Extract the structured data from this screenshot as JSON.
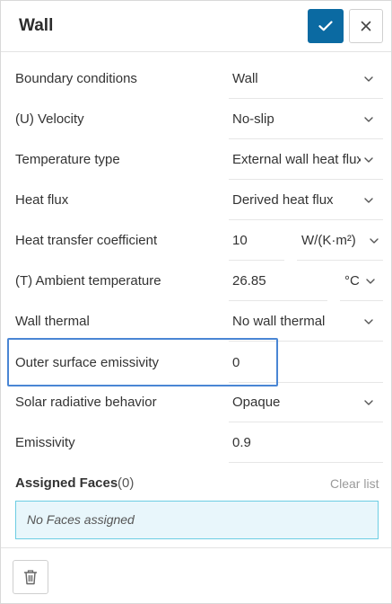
{
  "header": {
    "title": "Wall"
  },
  "rows": {
    "boundary_conditions": {
      "label": "Boundary conditions",
      "value": "Wall"
    },
    "velocity": {
      "label": "(U) Velocity",
      "value": "No-slip"
    },
    "temperature_type": {
      "label": "Temperature type",
      "value": "External wall heat flux"
    },
    "heat_flux": {
      "label": "Heat flux",
      "value": "Derived heat flux"
    },
    "heat_transfer_coefficient": {
      "label": "Heat transfer coefficient",
      "value": "10",
      "unit": "W/(K·m²)"
    },
    "ambient_temperature": {
      "label": "(T) Ambient temperature",
      "value": "26.85",
      "unit": "°C"
    },
    "wall_thermal": {
      "label": "Wall thermal",
      "value": "No wall thermal"
    },
    "outer_surface_emissivity": {
      "label": "Outer surface emissivity",
      "value": "0"
    },
    "solar_radiative_behavior": {
      "label": "Solar radiative behavior",
      "value": "Opaque"
    },
    "emissivity": {
      "label": "Emissivity",
      "value": "0.9"
    }
  },
  "assigned": {
    "label": "Assigned Faces",
    "count": "(0)",
    "clear_label": "Clear list",
    "empty_text": "No Faces assigned"
  },
  "colors": {
    "accent": "#0b6aa2",
    "highlight": "#4a86d4",
    "faces_bg": "#e8f6fb",
    "faces_border": "#6ccde3"
  },
  "icons": {
    "confirm": "check-icon",
    "close": "close-icon",
    "dropdown": "chevron-down-icon",
    "delete": "trash-icon"
  }
}
